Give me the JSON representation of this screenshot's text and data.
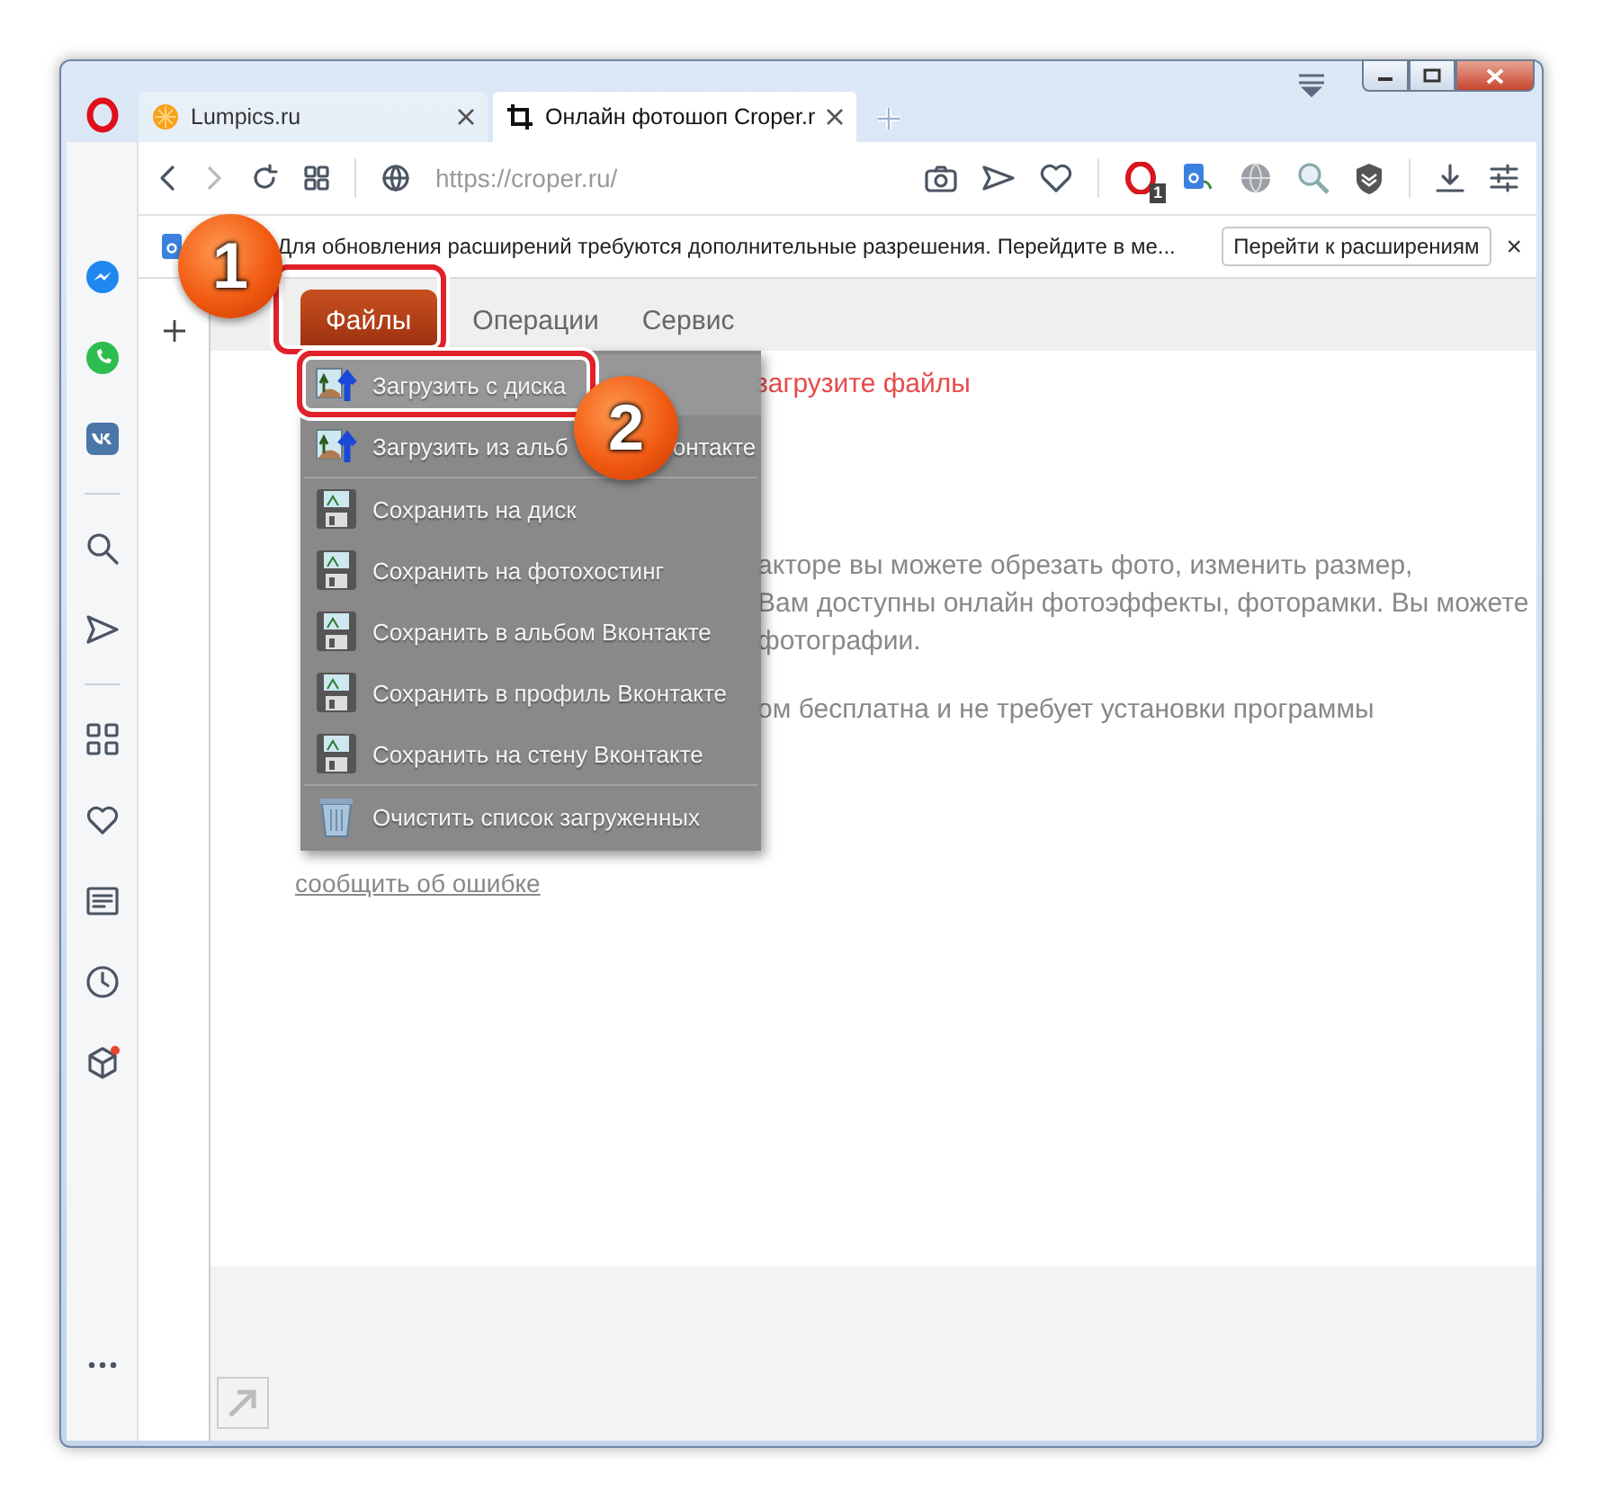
{
  "browser": {
    "tabs": [
      {
        "title": "Lumpics.ru",
        "selected": false
      },
      {
        "title": "Онлайн фотошоп Croper.r",
        "selected": true
      }
    ],
    "address": "https://croper.ru/",
    "extension_badge": "1"
  },
  "notification": {
    "text": "Для обновления расширений требуются дополнительные разрешения. Перейдите в ме...",
    "button": "Перейти к расширениям",
    "close": "×"
  },
  "site_nav": [
    {
      "label": "Файлы",
      "selected": true
    },
    {
      "label": "Операции",
      "selected": false
    },
    {
      "label": "Сервис",
      "selected": false
    }
  ],
  "menu": [
    {
      "label": "Загрузить с диска",
      "kind": "upload",
      "selected": true
    },
    {
      "label": "Загрузить из альб",
      "label_tail": "онтакте",
      "kind": "upload",
      "selected": false
    },
    {
      "label": "Сохранить на диск",
      "kind": "save",
      "selected": false
    },
    {
      "label": "Сохранить на фотохостинг",
      "kind": "save",
      "selected": false
    },
    {
      "label": "Сохранить в альбом Вконтакте",
      "kind": "save",
      "selected": false
    },
    {
      "label": "Сохранить в профиль Вконтакте",
      "kind": "save",
      "selected": false
    },
    {
      "label": "Сохранить на стену Вконтакте",
      "kind": "save",
      "selected": false
    },
    {
      "label": "Очистить список загруженных",
      "kind": "clear",
      "selected": false
    }
  ],
  "content": {
    "notice": "загрузите файлы",
    "visible_text": [
      "акторе вы можете обрезать фото, изменить размер,",
      "Вам доступны онлайн фотоэффекты, фоторамки. Вы можете",
      "фотографии.",
      "ом бесплатна и не требует установки программы"
    ],
    "report_link": "сообщить об ошибке"
  },
  "annotations": [
    {
      "label": "1"
    },
    {
      "label": "2"
    }
  ]
}
